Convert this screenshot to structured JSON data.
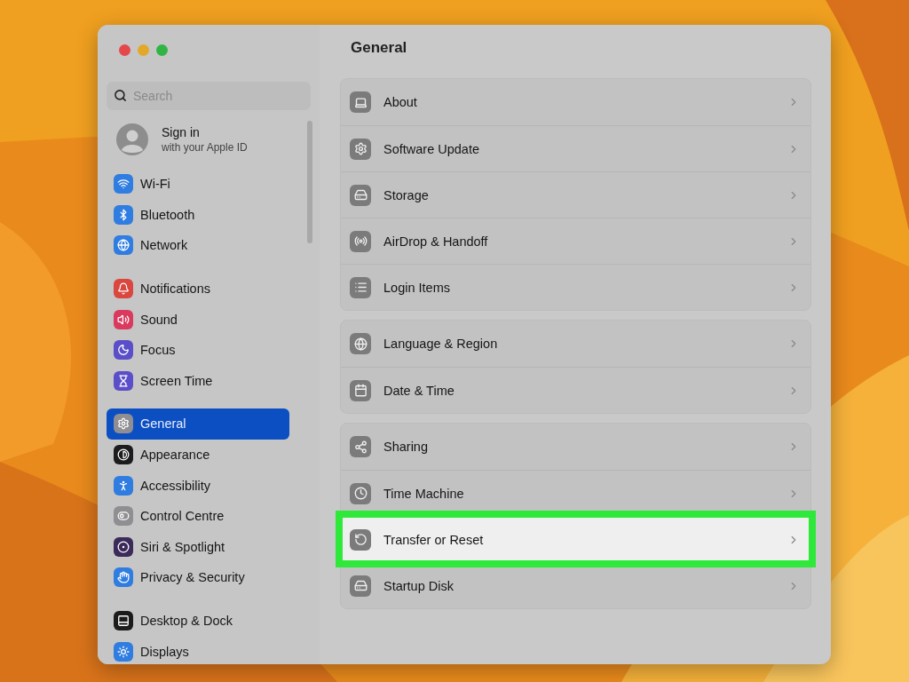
{
  "window": {
    "title": "General"
  },
  "sidebar": {
    "search": {
      "placeholder": "Search"
    },
    "account": {
      "title": "Sign in",
      "subtitle": "with your Apple ID"
    },
    "groups": [
      [
        {
          "label": "Wi-Fi",
          "color": "#2f7de1",
          "selected": false
        },
        {
          "label": "Bluetooth",
          "color": "#2f7de1",
          "selected": false
        },
        {
          "label": "Network",
          "color": "#2f7de1",
          "selected": false
        }
      ],
      [
        {
          "label": "Notifications",
          "color": "#d9473f",
          "selected": false
        },
        {
          "label": "Sound",
          "color": "#d93a5e",
          "selected": false
        },
        {
          "label": "Focus",
          "color": "#5b4fc9",
          "selected": false
        },
        {
          "label": "Screen Time",
          "color": "#5b4fc9",
          "selected": false
        }
      ],
      [
        {
          "label": "General",
          "color": "#8e8e93",
          "selected": true
        },
        {
          "label": "Appearance",
          "color": "#1c1c1e",
          "selected": false
        },
        {
          "label": "Accessibility",
          "color": "#2f7de1",
          "selected": false
        },
        {
          "label": "Control Centre",
          "color": "#8e8e93",
          "selected": false
        },
        {
          "label": "Siri & Spotlight",
          "color": "#3b2a5a",
          "selected": false
        },
        {
          "label": "Privacy & Security",
          "color": "#2f7de1",
          "selected": false
        }
      ],
      [
        {
          "label": "Desktop & Dock",
          "color": "#1c1c1e",
          "selected": false
        },
        {
          "label": "Displays",
          "color": "#2f7de1",
          "selected": false
        }
      ]
    ]
  },
  "content": {
    "groups": [
      [
        {
          "label": "About",
          "highlighted": false
        },
        {
          "label": "Software Update",
          "highlighted": false
        },
        {
          "label": "Storage",
          "highlighted": false
        },
        {
          "label": "AirDrop & Handoff",
          "highlighted": false
        },
        {
          "label": "Login Items",
          "highlighted": false
        }
      ],
      [
        {
          "label": "Language & Region",
          "highlighted": false
        },
        {
          "label": "Date & Time",
          "highlighted": false
        }
      ],
      [
        {
          "label": "Sharing",
          "highlighted": false
        },
        {
          "label": "Time Machine",
          "highlighted": false
        },
        {
          "label": "Transfer or Reset",
          "highlighted": true
        },
        {
          "label": "Startup Disk",
          "highlighted": false
        }
      ]
    ]
  }
}
